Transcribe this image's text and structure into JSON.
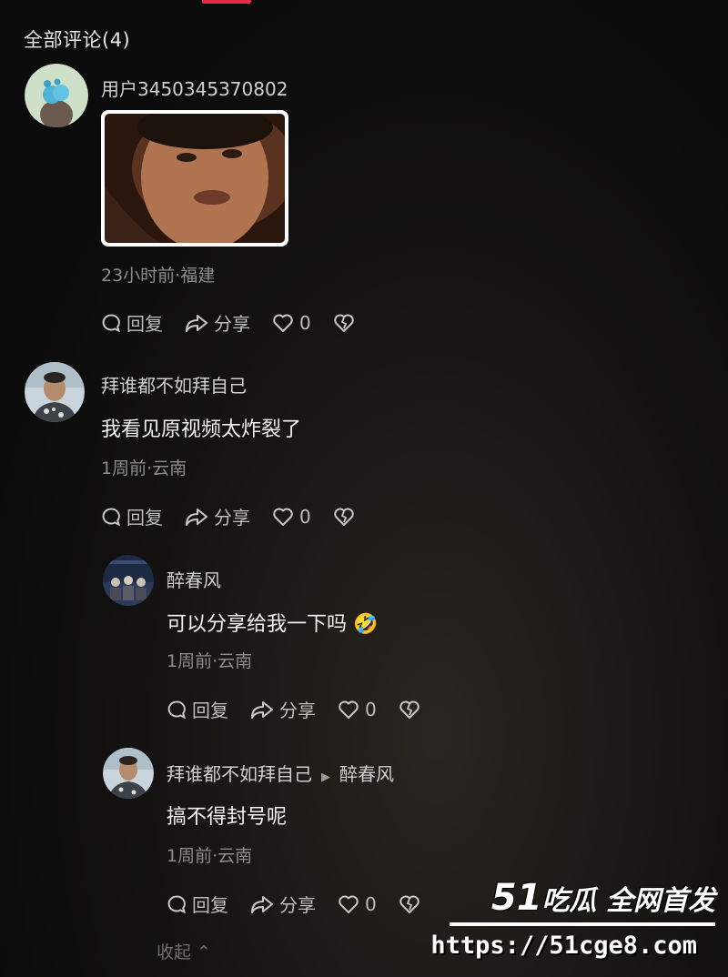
{
  "header": {
    "title": "全部评论(4)"
  },
  "comments": [
    {
      "username": "用户3450345370802",
      "has_image": true,
      "meta": "23小时前·福建",
      "reply_label": "回复",
      "share_label": "分享",
      "like_count": "0"
    },
    {
      "username": "拜谁都不如拜自己",
      "text": "我看见原视频太炸裂了",
      "meta": "1周前·云南",
      "reply_label": "回复",
      "share_label": "分享",
      "like_count": "0"
    },
    {
      "username": "醉春风",
      "text": "可以分享给我一下吗",
      "emoji": "🤣",
      "meta": "1周前·云南",
      "reply_label": "回复",
      "share_label": "分享",
      "like_count": "0"
    },
    {
      "username": "拜谁都不如拜自己",
      "reply_to": "醉春风",
      "text": "搞不得封号呢",
      "meta": "1周前·云南",
      "reply_label": "回复",
      "share_label": "分享",
      "like_count": "0"
    }
  ],
  "collapse_label": "收起",
  "watermark": {
    "brand_num": "51",
    "brand_text": "吃瓜 全网首发",
    "url": "https://51cge8.com"
  },
  "colors": {
    "accent": "#e8284a",
    "background": "#0e0e0e"
  }
}
